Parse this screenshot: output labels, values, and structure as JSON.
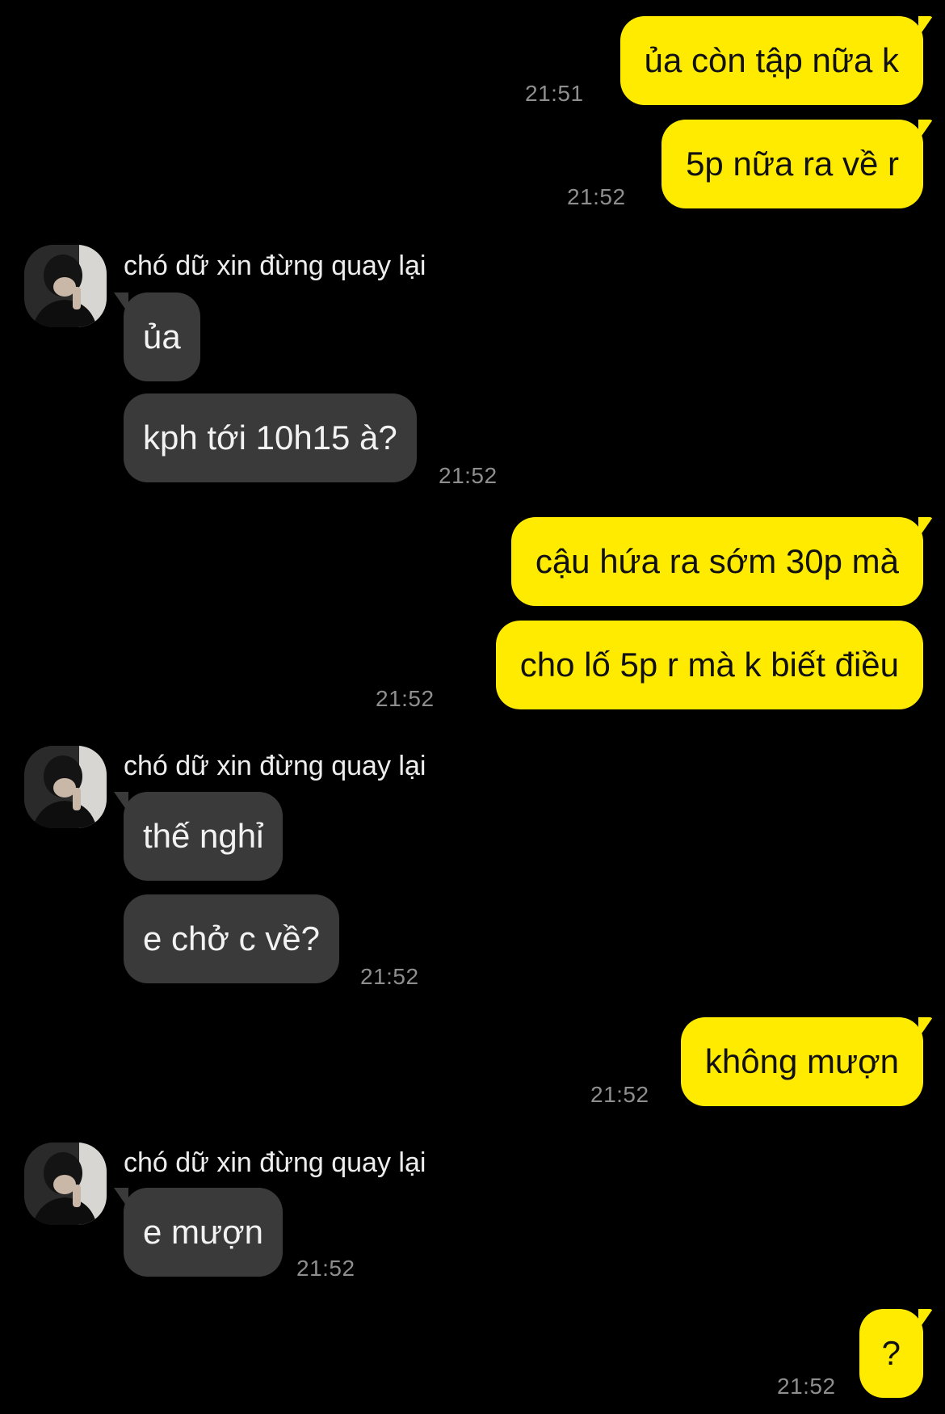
{
  "contact": {
    "name": "chó dữ xin đừng quay lại"
  },
  "messages": [
    {
      "side": "out",
      "text": "ủa còn tập nữa k",
      "time": "21:51"
    },
    {
      "side": "out",
      "text": "5p nữa ra về r",
      "time": "21:52"
    },
    {
      "side": "in",
      "text": "ủa",
      "time": ""
    },
    {
      "side": "in",
      "text": "kph tới 10h15 à?",
      "time": "21:52"
    },
    {
      "side": "out",
      "text": "cậu hứa ra sớm 30p mà",
      "time": ""
    },
    {
      "side": "out",
      "text": "cho lố 5p r mà k biết điều",
      "time": "21:52"
    },
    {
      "side": "in",
      "text": "thế nghỉ",
      "time": ""
    },
    {
      "side": "in",
      "text": "e chở c về?",
      "time": "21:52"
    },
    {
      "side": "out",
      "text": "không mượn",
      "time": "21:52"
    },
    {
      "side": "in",
      "text": "e mượn",
      "time": "21:52"
    },
    {
      "side": "out",
      "text": "?",
      "time": "21:52"
    }
  ],
  "colors": {
    "background": "#000000",
    "outgoing_bubble": "#FFEB00",
    "incoming_bubble": "#3A3A3A",
    "timestamp": "#8E8E8E"
  },
  "icons": {
    "avatar": "contact-avatar-photo"
  }
}
